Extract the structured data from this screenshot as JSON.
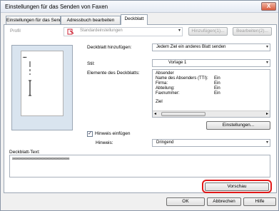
{
  "window": {
    "title": "Einstellungen für das Senden von Faxen",
    "close": "X"
  },
  "tabs": [
    {
      "label": "Einstellungen für das Senden"
    },
    {
      "label": "Adressbuch bearbeiten"
    },
    {
      "label": "Deckblatt"
    }
  ],
  "profile": {
    "label": "Profil",
    "value": "Standardeinstellungen",
    "add_button": "Hinzufügen(1)...",
    "edit_button": "Bearbeiten(2)..."
  },
  "cover_add": {
    "label": "Deckblatt hinzufügen:",
    "value": "Jedem Ziel ein anderes Blatt senden"
  },
  "style": {
    "label": "Stil:",
    "value": "Vorlage 1"
  },
  "elements": {
    "label": "Elemente des Deckblatts:",
    "rows": [
      {
        "name": "Absender",
        "value": ""
      },
      {
        "name": "Name des Absenders (TTI):",
        "value": "Ein"
      },
      {
        "name": "Firma:",
        "value": "Ein"
      },
      {
        "name": "Abteilung:",
        "value": "Ein"
      },
      {
        "name": "Faxnummer:",
        "value": "Ein"
      },
      {
        "name": "Ziel",
        "value": ""
      }
    ],
    "settings_button": "Einstellungen..."
  },
  "hint": {
    "checkbox_label": "Hinweis einfügen",
    "checked": true,
    "label": "Hinweis:",
    "value": "Dringend"
  },
  "cover_text": {
    "label": "Deckblatt-Text:",
    "value": "xxxxxxxxxxxxxxxxxxxxxxxxxxxxxxxxxxxxxxxx"
  },
  "buttons": {
    "preview": "Vorschau",
    "ok": "OK",
    "cancel": "Abbrechen",
    "help": "Hilfe"
  }
}
